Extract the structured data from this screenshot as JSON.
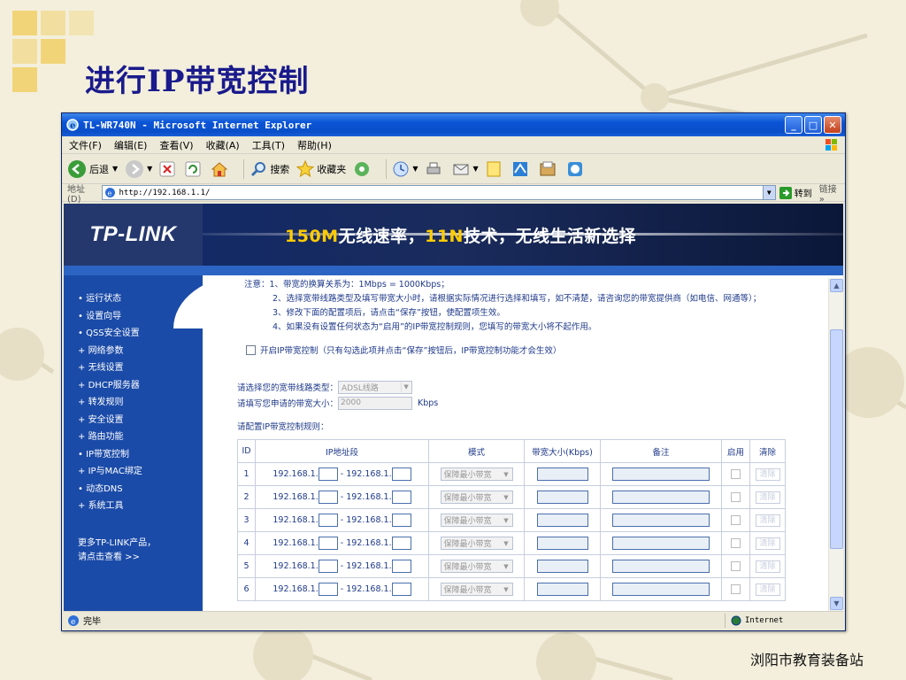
{
  "slide": {
    "title": "进行IP带宽控制",
    "footer": "浏阳市教育装备站"
  },
  "window": {
    "title": "TL-WR740N - Microsoft Internet Explorer"
  },
  "menu": [
    "文件(F)",
    "编辑(E)",
    "查看(V)",
    "收藏(A)",
    "工具(T)",
    "帮助(H)"
  ],
  "toolbar": {
    "back": "后退",
    "search": "搜索",
    "favorites": "收藏夹"
  },
  "address": {
    "label": "地址(D)",
    "url": "http://192.168.1.1/",
    "go": "转到",
    "links": "链接"
  },
  "banner": {
    "logo": "TP-LINK",
    "slogan_a": "150M",
    "slogan_b": "无线速率，",
    "slogan_c": "11N",
    "slogan_d": "技术，无线生活新选择"
  },
  "sidebar": {
    "items": [
      "运行状态",
      "设置向导",
      "QSS安全设置",
      "网络参数",
      "无线设置",
      "DHCP服务器",
      "转发规则",
      "安全设置",
      "路由功能",
      "IP带宽控制",
      "IP与MAC绑定",
      "动态DNS",
      "系统工具"
    ],
    "more_1": "更多TP-LINK产品，",
    "more_2": "请点击查看 >>"
  },
  "main": {
    "note_title": "注意：1、带宽的换算关系为：1Mbps = 1000Kbps；",
    "note_2": "2、选择宽带线路类型及填写带宽大小时，请根据实际情况进行选择和填写，如不清楚，请咨询您的带宽提供商（如电信、网通等）；",
    "note_3": "3、修改下面的配置项后，请点击“保存”按钮，使配置项生效。",
    "note_4": "4、如果没有设置任何状态为“启用”的IP带宽控制规则，您填写的带宽大小将不起作用。",
    "enable_label": "开启IP带宽控制（只有勾选此项并点击“保存”按钮后，IP带宽控制功能才会生效）",
    "line_type_label": "请选择您的宽带线路类型：",
    "line_type_value": "ADSL线路",
    "bandwidth_label": "请填写您申请的带宽大小：",
    "bandwidth_value": "2000",
    "bandwidth_unit": "Kbps",
    "rules_label": "请配置IP带宽控制规则："
  },
  "table": {
    "headers": [
      "ID",
      "IP地址段",
      "模式",
      "带宽大小(Kbps)",
      "备注",
      "启用",
      "清除"
    ],
    "ip_prefix": "192.168.1.",
    "ip_sep": "- 192.168.1.",
    "mode": "保障最小带宽",
    "clear": "清除",
    "ids": [
      "1",
      "2",
      "3",
      "4",
      "5",
      "6"
    ]
  },
  "status": {
    "left": "完毕",
    "zone": "Internet"
  }
}
